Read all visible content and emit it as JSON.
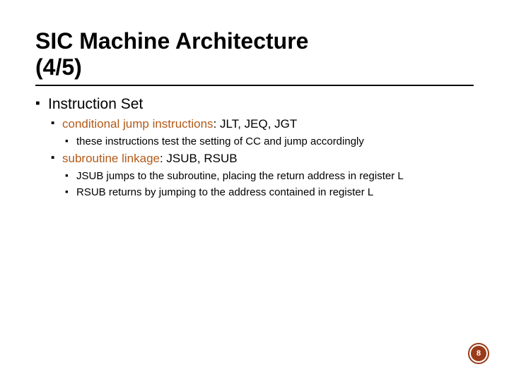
{
  "title_line1": "SIC Machine Architecture",
  "title_line2": "(4/5)",
  "lvl1_heading": "Instruction Set",
  "item1_accent": "conditional jump instructions",
  "item1_rest": ": JLT, JEQ, JGT",
  "item1_sub1": "these instructions test the setting of CC and jump accordingly",
  "item2_accent": "subroutine linkage",
  "item2_rest": ": JSUB, RSUB",
  "item2_sub1": "JSUB jumps to the subroutine, placing the return address in register L",
  "item2_sub2": "RSUB returns by jumping to the address contained in register L",
  "page_number": "8"
}
